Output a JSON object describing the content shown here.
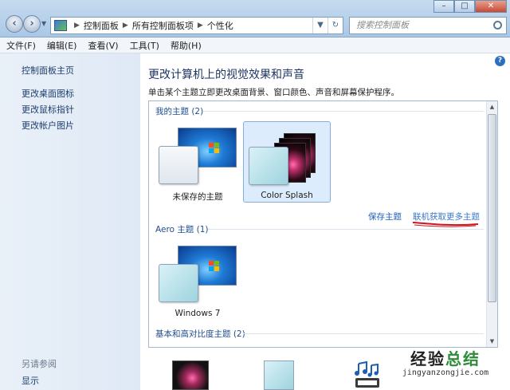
{
  "breadcrumb": [
    "控制面板",
    "所有控制面板项",
    "个性化"
  ],
  "search": {
    "placeholder": "搜索控制面板"
  },
  "menu": [
    "文件(F)",
    "编辑(E)",
    "查看(V)",
    "工具(T)",
    "帮助(H)"
  ],
  "sidebar": {
    "home": "控制面板主页",
    "links": [
      "更改桌面图标",
      "更改鼠标指针",
      "更改帐户图片"
    ],
    "see_also": "另请参阅",
    "display": "显示"
  },
  "main": {
    "title": "更改计算机上的视觉效果和声音",
    "subtitle": "单击某个主题立即更改桌面背景、窗口颜色、声音和屏幕保护程序。"
  },
  "groups": {
    "my_themes": "我的主题 (2)",
    "aero_themes": "Aero 主题 (1)",
    "basic_themes": "基本和高对比度主题 (2)"
  },
  "themes": {
    "unsaved": "未保存的主题",
    "color_splash": "Color Splash",
    "windows7": "Windows 7"
  },
  "actions": {
    "save_theme": "保存主题",
    "more_themes": "联机获取更多主题"
  },
  "watermark": {
    "main_a": "经验",
    "main_b": "总结",
    "url": "jingyanzongjie.com"
  },
  "colors": {
    "link": "#1e5fb4",
    "annotation": "#d0141e",
    "selection": "#dcecfc"
  }
}
